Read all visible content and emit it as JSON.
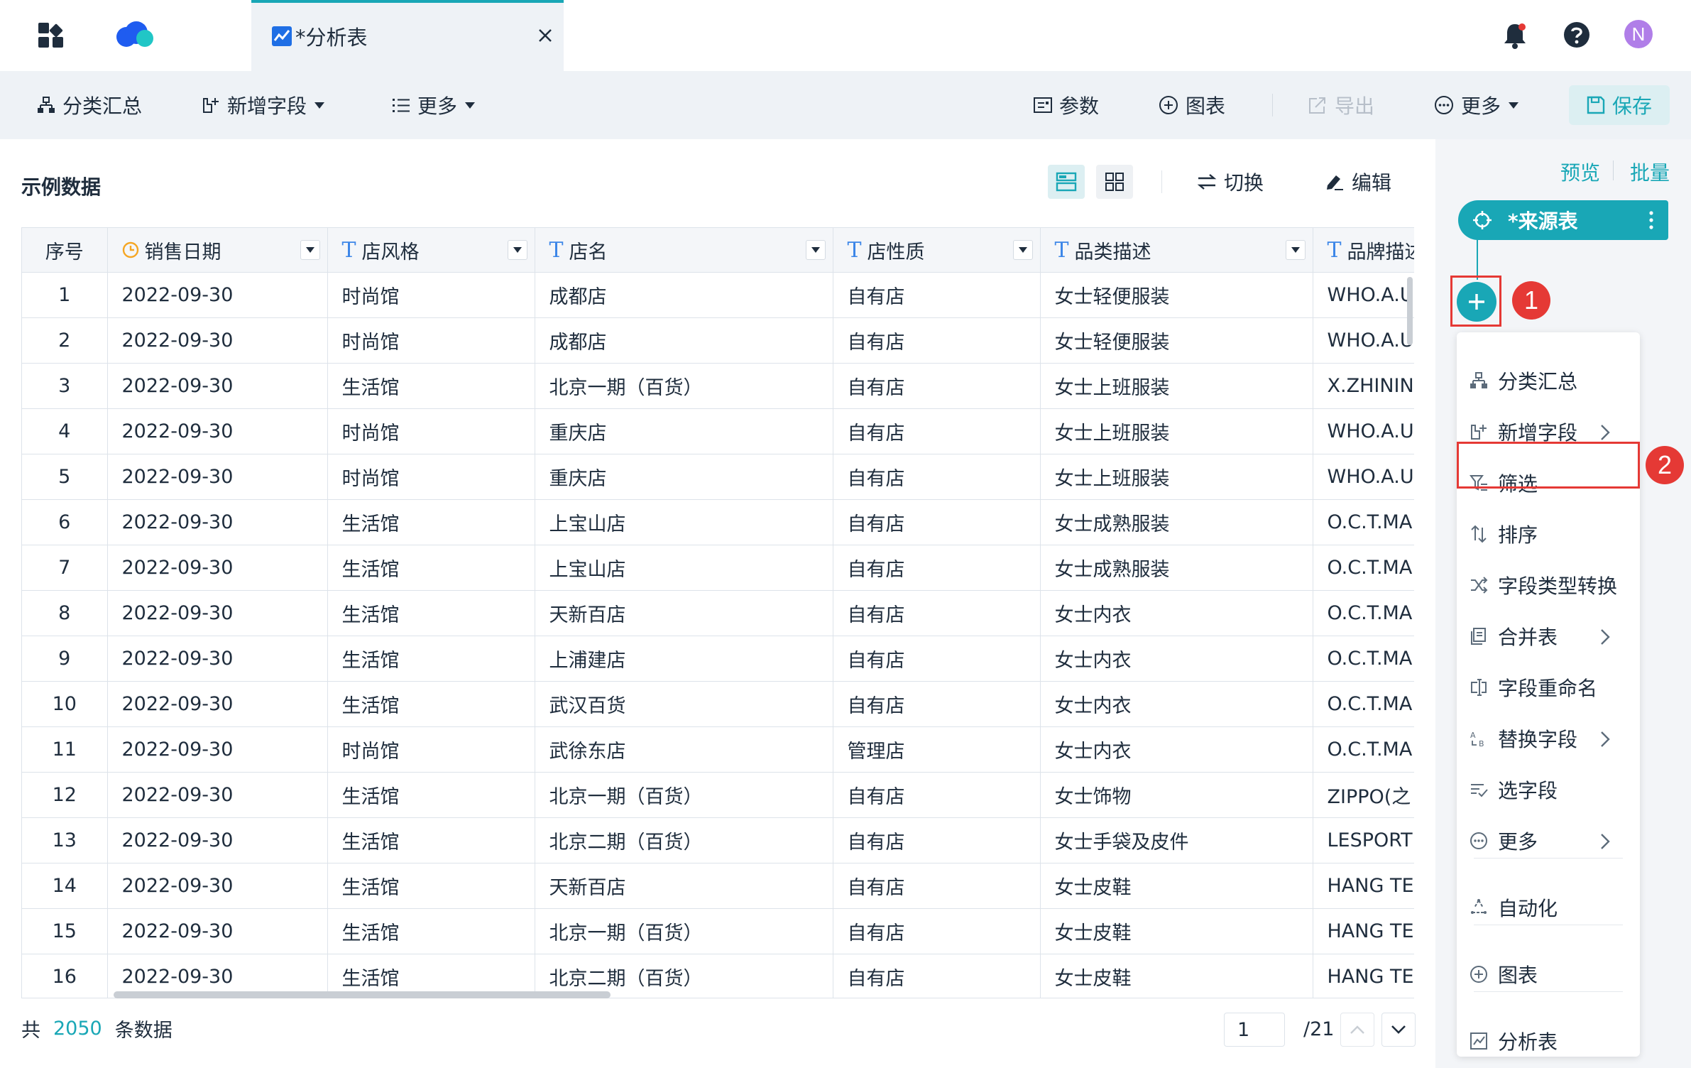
{
  "colors": {
    "accent": "#19a7b6",
    "annotation": "#e53935",
    "avatar": "#b07ee8",
    "type_icon": "#3c86e8"
  },
  "topbar": {
    "tab_title": "*分析表",
    "avatar_letter": "N",
    "icons": [
      "grid-icon",
      "logo",
      "chart-icon",
      "close-icon",
      "bell-icon",
      "help-icon"
    ]
  },
  "toolbar": {
    "group_summary": "分类汇总",
    "add_field": "新增字段",
    "more_left": "更多",
    "params": "参数",
    "chart": "图表",
    "export": "导出",
    "more_right": "更多",
    "save": "保存"
  },
  "main": {
    "title": "示例数据",
    "switch": "切换",
    "edit": "编辑"
  },
  "table": {
    "columns": [
      {
        "label": "序号",
        "type": ""
      },
      {
        "label": "销售日期",
        "type": "date"
      },
      {
        "label": "店风格",
        "type": "T"
      },
      {
        "label": "店名",
        "type": "T"
      },
      {
        "label": "店性质",
        "type": "T"
      },
      {
        "label": "品类描述",
        "type": "T"
      },
      {
        "label": "品牌描述",
        "type": "T"
      }
    ],
    "rows": [
      [
        "1",
        "2022-09-30",
        "时尚馆",
        "成都店",
        "自有店",
        "女士轻便服装",
        "WHO.A.U"
      ],
      [
        "2",
        "2022-09-30",
        "时尚馆",
        "成都店",
        "自有店",
        "女士轻便服装",
        "WHO.A.U"
      ],
      [
        "3",
        "2022-09-30",
        "生活馆",
        "北京一期（百货）",
        "自有店",
        "女士上班服装",
        "X.ZHININ"
      ],
      [
        "4",
        "2022-09-30",
        "时尚馆",
        "重庆店",
        "自有店",
        "女士上班服装",
        "WHO.A.U"
      ],
      [
        "5",
        "2022-09-30",
        "时尚馆",
        "重庆店",
        "自有店",
        "女士上班服装",
        "WHO.A.U"
      ],
      [
        "6",
        "2022-09-30",
        "生活馆",
        "上宝山店",
        "自有店",
        "女士成熟服装",
        "O.C.T.MA"
      ],
      [
        "7",
        "2022-09-30",
        "生活馆",
        "上宝山店",
        "自有店",
        "女士成熟服装",
        "O.C.T.MA"
      ],
      [
        "8",
        "2022-09-30",
        "生活馆",
        "天新百店",
        "自有店",
        "女士内衣",
        "O.C.T.MA"
      ],
      [
        "9",
        "2022-09-30",
        "生活馆",
        "上浦建店",
        "自有店",
        "女士内衣",
        "O.C.T.MA"
      ],
      [
        "10",
        "2022-09-30",
        "生活馆",
        "武汉百货",
        "自有店",
        "女士内衣",
        "O.C.T.MA"
      ],
      [
        "11",
        "2022-09-30",
        "时尚馆",
        "武徐东店",
        "管理店",
        "女士内衣",
        "O.C.T.MA"
      ],
      [
        "12",
        "2022-09-30",
        "生活馆",
        "北京一期（百货）",
        "自有店",
        "女士饰物",
        "ZIPPO(之"
      ],
      [
        "13",
        "2022-09-30",
        "生活馆",
        "北京二期（百货）",
        "自有店",
        "女士手袋及皮件",
        "LESPORT"
      ],
      [
        "14",
        "2022-09-30",
        "生活馆",
        "天新百店",
        "自有店",
        "女士皮鞋",
        "HANG TE"
      ],
      [
        "15",
        "2022-09-30",
        "生活馆",
        "北京一期（百货）",
        "自有店",
        "女士皮鞋",
        "HANG TE"
      ],
      [
        "16",
        "2022-09-30",
        "生活馆",
        "北京二期（百货）",
        "自有店",
        "女士皮鞋",
        "HANG TE"
      ]
    ]
  },
  "footer": {
    "prefix": "共",
    "total": "2050",
    "suffix": "条数据",
    "page": "1",
    "page_total": "/21"
  },
  "right_panel": {
    "preview": "预览",
    "batch": "批量",
    "source_node": "*来源表",
    "badge_1": "1",
    "badge_2": "2",
    "menu": [
      {
        "label": "分类汇总",
        "icon": "group-summary-icon",
        "submenu": false
      },
      {
        "label": "新增字段",
        "icon": "add-field-icon",
        "submenu": true
      },
      {
        "label": "筛选",
        "icon": "filter-icon",
        "submenu": false
      },
      {
        "label": "排序",
        "icon": "sort-icon",
        "submenu": false
      },
      {
        "label": "字段类型转换",
        "icon": "shuffle-icon",
        "submenu": false
      },
      {
        "label": "合并表",
        "icon": "merge-icon",
        "submenu": true
      },
      {
        "label": "字段重命名",
        "icon": "rename-icon",
        "submenu": false
      },
      {
        "label": "替换字段",
        "icon": "replace-icon",
        "submenu": true
      },
      {
        "label": "选字段",
        "icon": "select-field-icon",
        "submenu": false
      },
      {
        "label": "更多",
        "icon": "more-icon",
        "submenu": true
      },
      {
        "label": "自动化",
        "icon": "automation-icon",
        "submenu": false
      },
      {
        "label": "图表",
        "icon": "chart-add-icon",
        "submenu": false
      },
      {
        "label": "分析表",
        "icon": "analysis-table-icon",
        "submenu": false
      }
    ]
  }
}
